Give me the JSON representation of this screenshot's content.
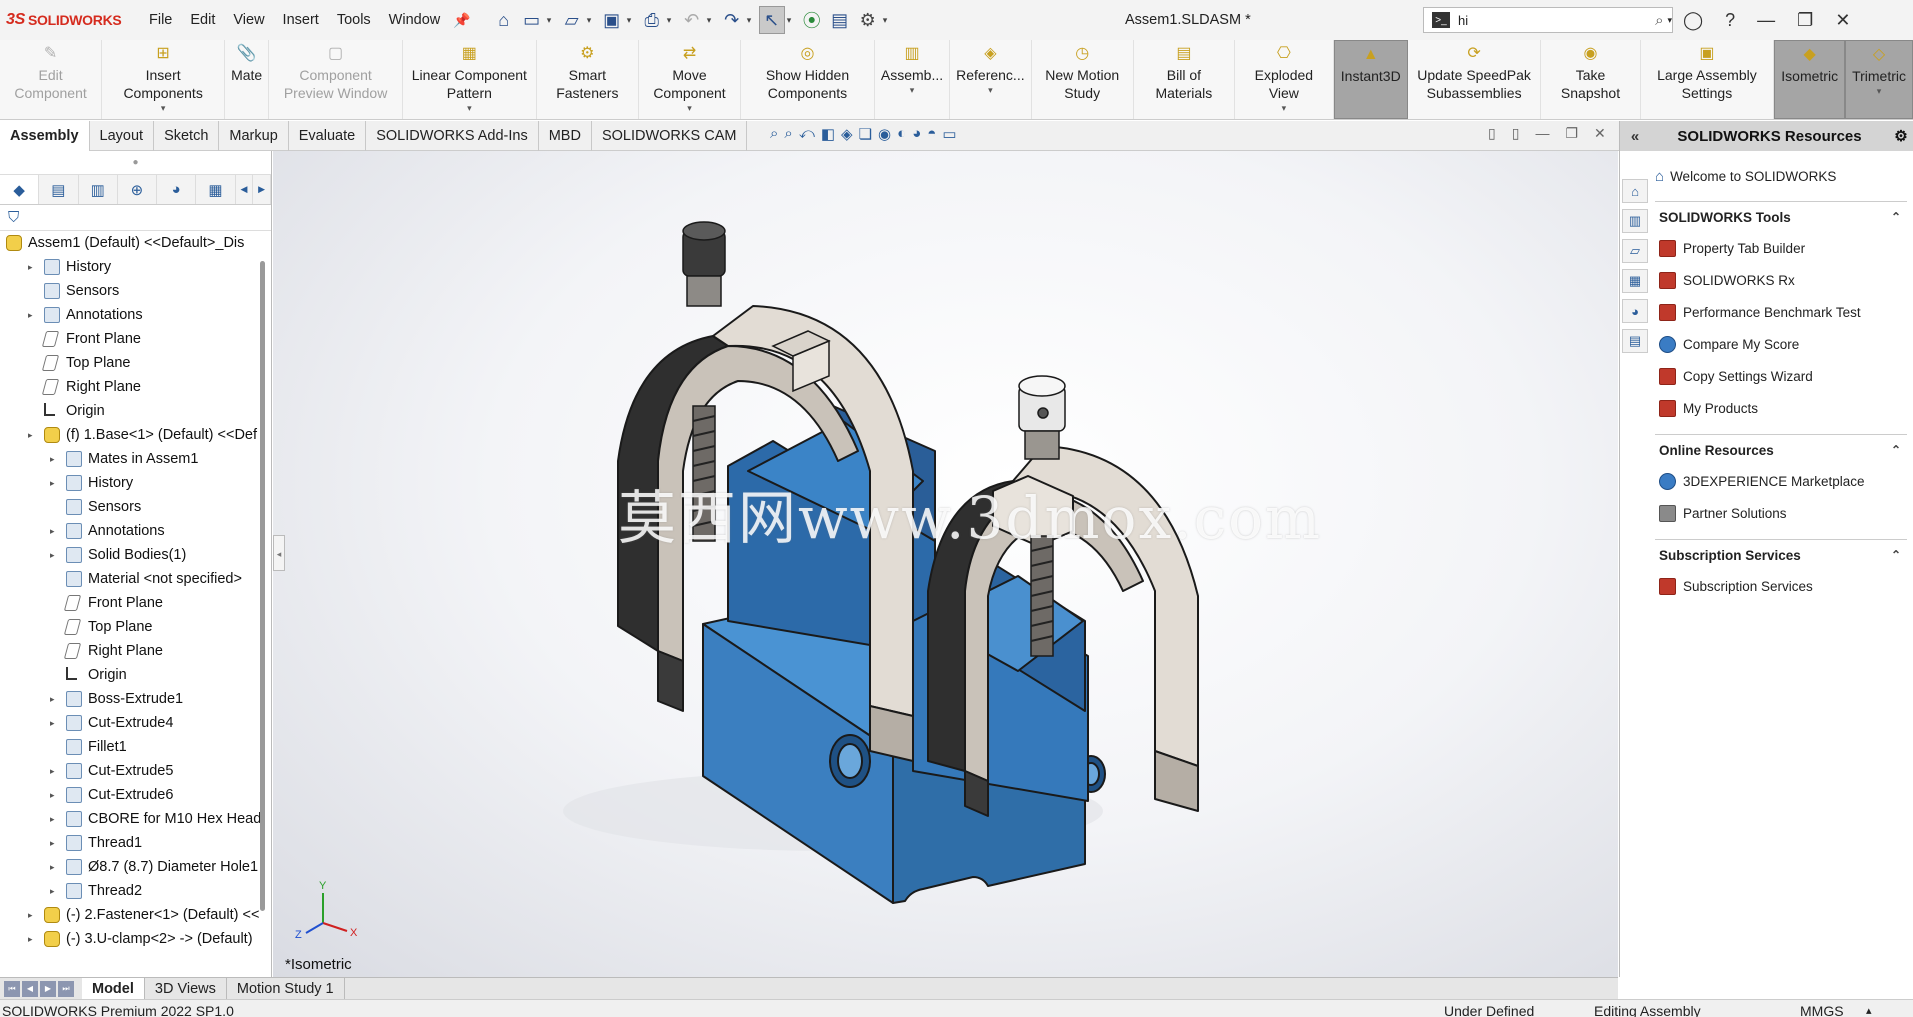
{
  "app": {
    "logo_text": "SOLIDWORKS",
    "document_title": "Assem1.SLDASM *"
  },
  "menu": [
    "File",
    "Edit",
    "View",
    "Insert",
    "Tools",
    "Window"
  ],
  "search": {
    "value": "hi"
  },
  "command_manager": [
    {
      "label": "Edit Component",
      "disabled": true
    },
    {
      "label": "Insert Components"
    },
    {
      "label": "Mate"
    },
    {
      "label": "Component Preview Window",
      "disabled": true
    },
    {
      "label": "Linear Component Pattern"
    },
    {
      "label": "Smart Fasteners"
    },
    {
      "label": "Move Component"
    },
    {
      "label": "Show Hidden Components"
    },
    {
      "label": "Assemb..."
    },
    {
      "label": "Referenc..."
    },
    {
      "label": "New Motion Study"
    },
    {
      "label": "Bill of Materials"
    },
    {
      "label": "Exploded View"
    },
    {
      "label": "Instant3D",
      "active": true
    },
    {
      "label": "Update SpeedPak Subassemblies"
    },
    {
      "label": "Take Snapshot"
    },
    {
      "label": "Large Assembly Settings"
    },
    {
      "label": "Isometric",
      "active": true
    },
    {
      "label": "Trimetric",
      "active": true
    }
  ],
  "command_tabs": [
    "Assembly",
    "Layout",
    "Sketch",
    "Markup",
    "Evaluate",
    "SOLIDWORKS Add-Ins",
    "MBD",
    "SOLIDWORKS CAM"
  ],
  "feature_tree": [
    {
      "label": "Assem1 (Default) <<Default>_Dis",
      "level": 0,
      "icon": "asm",
      "expand": false
    },
    {
      "label": "History",
      "level": 1,
      "icon": "box",
      "expand": true
    },
    {
      "label": "Sensors",
      "level": 1,
      "icon": "box",
      "expand": false
    },
    {
      "label": "Annotations",
      "level": 1,
      "icon": "box",
      "expand": true
    },
    {
      "label": "Front Plane",
      "level": 1,
      "icon": "plane",
      "expand": false
    },
    {
      "label": "Top Plane",
      "level": 1,
      "icon": "plane",
      "expand": false
    },
    {
      "label": "Right Plane",
      "level": 1,
      "icon": "plane",
      "expand": false
    },
    {
      "label": "Origin",
      "level": 1,
      "icon": "origin",
      "expand": false
    },
    {
      "label": "(f) 1.Base<1> (Default) <<Def",
      "level": 1,
      "icon": "asm",
      "expand": true
    },
    {
      "label": "Mates in Assem1",
      "level": 2,
      "icon": "box",
      "expand": true
    },
    {
      "label": "History",
      "level": 2,
      "icon": "box",
      "expand": true
    },
    {
      "label": "Sensors",
      "level": 2,
      "icon": "box",
      "expand": false
    },
    {
      "label": "Annotations",
      "level": 2,
      "icon": "box",
      "expand": true
    },
    {
      "label": "Solid Bodies(1)",
      "level": 2,
      "icon": "box",
      "expand": true
    },
    {
      "label": "Material <not specified>",
      "level": 2,
      "icon": "box",
      "expand": false
    },
    {
      "label": "Front Plane",
      "level": 2,
      "icon": "plane",
      "expand": false
    },
    {
      "label": "Top Plane",
      "level": 2,
      "icon": "plane",
      "expand": false
    },
    {
      "label": "Right Plane",
      "level": 2,
      "icon": "plane",
      "expand": false
    },
    {
      "label": "Origin",
      "level": 2,
      "icon": "origin",
      "expand": false
    },
    {
      "label": "Boss-Extrude1",
      "level": 2,
      "icon": "box",
      "expand": true
    },
    {
      "label": "Cut-Extrude4",
      "level": 2,
      "icon": "box",
      "expand": true
    },
    {
      "label": "Fillet1",
      "level": 2,
      "icon": "box",
      "expand": false
    },
    {
      "label": "Cut-Extrude5",
      "level": 2,
      "icon": "box",
      "expand": true
    },
    {
      "label": "Cut-Extrude6",
      "level": 2,
      "icon": "box",
      "expand": true
    },
    {
      "label": "CBORE for M10 Hex Head",
      "level": 2,
      "icon": "box",
      "expand": true
    },
    {
      "label": "Thread1",
      "level": 2,
      "icon": "box",
      "expand": true
    },
    {
      "label": "Ø8.7 (8.7) Diameter Hole1",
      "level": 2,
      "icon": "box",
      "expand": true
    },
    {
      "label": "Thread2",
      "level": 2,
      "icon": "box",
      "expand": true
    },
    {
      "label": "(-) 2.Fastener<1> (Default) <<",
      "level": 1,
      "icon": "asm",
      "expand": true
    },
    {
      "label": "(-) 3.U-clamp<2> -> (Default)",
      "level": 1,
      "icon": "asm",
      "expand": true
    }
  ],
  "viewport": {
    "watermark": "莫西网www.3dmox.com",
    "view_name": "*Isometric",
    "triad": {
      "x": "X",
      "y": "Y",
      "z": "Z"
    },
    "colors": {
      "base": "#3f86c8",
      "clamp": "#ded8d0",
      "dark": "#2f2f2f"
    }
  },
  "task_pane": {
    "title": "SOLIDWORKS Resources",
    "welcome": "Welcome to SOLIDWORKS",
    "sections": [
      {
        "title": "SOLIDWORKS Tools",
        "items": [
          "Property Tab Builder",
          "SOLIDWORKS Rx",
          "Performance Benchmark Test",
          "Compare My Score",
          "Copy Settings Wizard",
          "My Products"
        ]
      },
      {
        "title": "Online Resources",
        "items": [
          "3DEXPERIENCE Marketplace",
          "Partner Solutions"
        ]
      },
      {
        "title": "Subscription Services",
        "items": [
          "Subscription Services"
        ]
      }
    ]
  },
  "bottom_tabs": [
    "Model",
    "3D Views",
    "Motion Study 1"
  ],
  "status": {
    "product": "SOLIDWORKS Premium 2022 SP1.0",
    "state": "Under Defined",
    "mode": "Editing Assembly",
    "units": "MMGS"
  }
}
